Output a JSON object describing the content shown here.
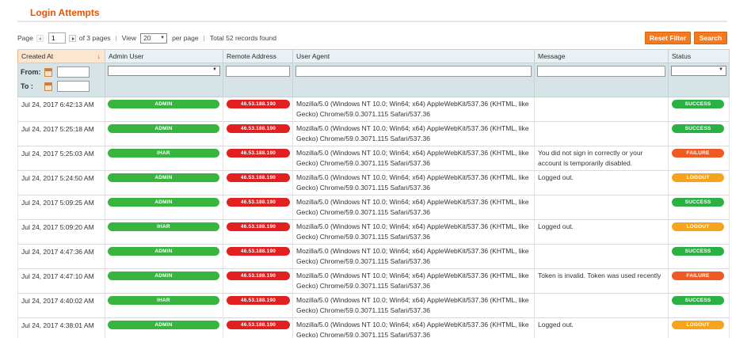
{
  "page": {
    "title": "Login Attempts"
  },
  "pager": {
    "page_label": "Page",
    "current_page": "1",
    "of_pages": "of 3 pages",
    "view_label": "View",
    "per_page_value": "20",
    "per_page_label": "per page",
    "total": "Total 52 records found"
  },
  "buttons": {
    "reset": "Reset Filter",
    "search": "Search"
  },
  "columns": {
    "created_at": "Created At",
    "admin_user": "Admin User",
    "remote_address": "Remote Address",
    "user_agent": "User Agent",
    "message": "Message",
    "status": "Status"
  },
  "filters": {
    "from_label": "From:",
    "to_label": "To :"
  },
  "rows": [
    {
      "date": "Jul 24, 2017 6:42:13 AM",
      "user": "ADMIN",
      "ip": "46.53.188.190",
      "agent": "Mozilla/5.0 (Windows NT 10.0; Win64; x64) AppleWebKit/537.36 (KHTML, like Gecko) Chrome/59.0.3071.115 Safari/537.36",
      "message": "",
      "status": "SUCCESS",
      "status_type": "success"
    },
    {
      "date": "Jul 24, 2017 5:25:18 AM",
      "user": "ADMIN",
      "ip": "46.53.188.190",
      "agent": "Mozilla/5.0 (Windows NT 10.0; Win64; x64) AppleWebKit/537.36 (KHTML, like Gecko) Chrome/59.0.3071.115 Safari/537.36",
      "message": "",
      "status": "SUCCESS",
      "status_type": "success"
    },
    {
      "date": "Jul 24, 2017 5:25:03 AM",
      "user": "IHAR",
      "ip": "46.53.188.190",
      "agent": "Mozilla/5.0 (Windows NT 10.0; Win64; x64) AppleWebKit/537.36 (KHTML, like Gecko) Chrome/59.0.3071.115 Safari/537.36",
      "message": "You did not sign in correctly or your account is temporarily disabled.",
      "status": "FAILURE",
      "status_type": "failure"
    },
    {
      "date": "Jul 24, 2017 5:24:50 AM",
      "user": "ADMIN",
      "ip": "46.53.188.190",
      "agent": "Mozilla/5.0 (Windows NT 10.0; Win64; x64) AppleWebKit/537.36 (KHTML, like Gecko) Chrome/59.0.3071.115 Safari/537.36",
      "message": "Logged out.",
      "status": "LOGOUT",
      "status_type": "logout"
    },
    {
      "date": "Jul 24, 2017 5:09:25 AM",
      "user": "ADMIN",
      "ip": "46.53.188.190",
      "agent": "Mozilla/5.0 (Windows NT 10.0; Win64; x64) AppleWebKit/537.36 (KHTML, like Gecko) Chrome/59.0.3071.115 Safari/537.36",
      "message": "",
      "status": "SUCCESS",
      "status_type": "success"
    },
    {
      "date": "Jul 24, 2017 5:09:20 AM",
      "user": "IHAR",
      "ip": "46.53.188.190",
      "agent": "Mozilla/5.0 (Windows NT 10.0; Win64; x64) AppleWebKit/537.36 (KHTML, like Gecko) Chrome/59.0.3071.115 Safari/537.36",
      "message": "Logged out.",
      "status": "LOGOUT",
      "status_type": "logout"
    },
    {
      "date": "Jul 24, 2017 4:47:36 AM",
      "user": "ADMIN",
      "ip": "46.53.188.190",
      "agent": "Mozilla/5.0 (Windows NT 10.0; Win64; x64) AppleWebKit/537.36 (KHTML, like Gecko) Chrome/59.0.3071.115 Safari/537.36",
      "message": "",
      "status": "SUCCESS",
      "status_type": "success"
    },
    {
      "date": "Jul 24, 2017 4:47:10 AM",
      "user": "ADMIN",
      "ip": "46.53.188.190",
      "agent": "Mozilla/5.0 (Windows NT 10.0; Win64; x64) AppleWebKit/537.36 (KHTML, like Gecko) Chrome/59.0.3071.115 Safari/537.36",
      "message": "Token is invalid. Token was used recently",
      "status": "FAILURE",
      "status_type": "failure"
    },
    {
      "date": "Jul 24, 2017 4:40:02 AM",
      "user": "IHAR",
      "ip": "46.53.188.190",
      "agent": "Mozilla/5.0 (Windows NT 10.0; Win64; x64) AppleWebKit/537.36 (KHTML, like Gecko) Chrome/59.0.3071.115 Safari/537.36",
      "message": "",
      "status": "SUCCESS",
      "status_type": "success"
    },
    {
      "date": "Jul 24, 2017 4:38:01 AM",
      "user": "ADMIN",
      "ip": "46.53.188.190",
      "agent": "Mozilla/5.0 (Windows NT 10.0; Win64; x64) AppleWebKit/537.36 (KHTML, like Gecko) Chrome/59.0.3071.115 Safari/537.36",
      "message": "Logged out.",
      "status": "LOGOUT",
      "status_type": "logout"
    }
  ]
}
